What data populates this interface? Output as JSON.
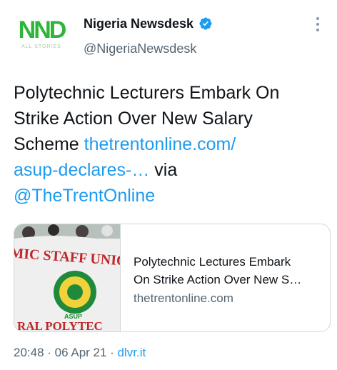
{
  "author": {
    "avatar_text": "NND",
    "avatar_subtext": "ALL STORIES",
    "display_name": "Nigeria Newsdesk",
    "handle": "@NigeriaNewsdesk",
    "verified": true
  },
  "tweet": {
    "text_part1": "Polytechnic Lecturers Embark On Strike Action Over New Salary Scheme ",
    "link_part1": "thetrentonline.com/",
    "link_part2": "asup-declares-…",
    "text_part2": " via ",
    "mention": "@TheTrentOnline"
  },
  "card": {
    "title_line1": "Polytechnic Lectures Embark",
    "title_line2": "On Strike Action Over New S…",
    "domain": "thetrentonline.com",
    "image_banner_text": "MIC STAFF UNION OF PO",
    "image_banner_text2": "RAL POLYTEC",
    "image_logo_text": "ASUP"
  },
  "meta": {
    "time": "20:48",
    "separator": " · ",
    "date": "06 Apr 21",
    "source": "dlvr.it"
  },
  "colors": {
    "accent": "#1d9bf0",
    "text": "#0f1419",
    "secondary": "#536471",
    "avatar_green": "#2fb53a"
  }
}
